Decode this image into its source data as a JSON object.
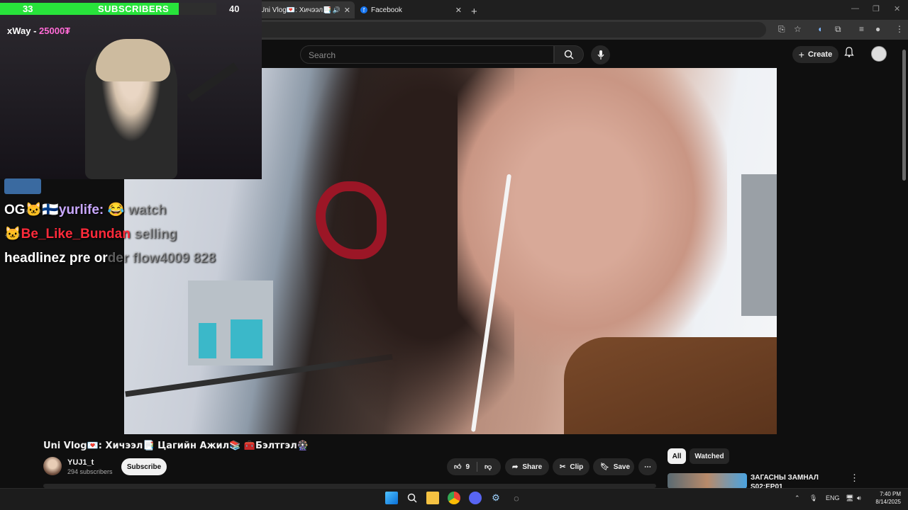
{
  "browser": {
    "tabs": [
      {
        "label": "Uni Vlog💌: Хичээл📑Цагийн",
        "active": true
      },
      {
        "label": "Facebook",
        "active": false
      }
    ],
    "new_tab_label": "+"
  },
  "youtube": {
    "search_placeholder": "Search",
    "create_label": "Create",
    "video": {
      "title": "Uni Vlog💌: Хичээл📑 Цагийн Ажил📚 🧰Бэлтгэл🎡",
      "channel_name": "YUJ1_t",
      "channel_subs": "294 subscribers",
      "subscribe_label": "Subscribe",
      "likes": "9",
      "share_label": "Share",
      "clip_label": "Clip",
      "save_label": "Save"
    },
    "sidebar": {
      "chips": [
        "All",
        "Watched"
      ],
      "reco_title": "ЗАГАСНЫ ЗАМНАЛ S02:EP01"
    }
  },
  "stream_overlay": {
    "sub_current": "33",
    "sub_label": "SUBSCRIBERS",
    "sub_goal": "40",
    "sub_progress": 0.825,
    "goal_text": "xWay - ",
    "goal_amount": "25000₮",
    "chat": [
      {
        "prefix": "OG🐱🇫🇮",
        "name": "yurlife:",
        "message": "watch"
      },
      {
        "prefix": "🐱",
        "name": "Be_Like_Bundan",
        "message": "selling"
      },
      {
        "prefix": "",
        "name": "",
        "message": "headlinez pre or",
        "faded": "der flow4009 828"
      }
    ]
  },
  "taskbar": {
    "lang": "ENG",
    "time": "7:40 PM",
    "date": "8/14/2025"
  },
  "colors": {
    "accent_green": "#28e33b",
    "yt_bg": "#0f0f0f",
    "pill_bg": "#272727"
  }
}
